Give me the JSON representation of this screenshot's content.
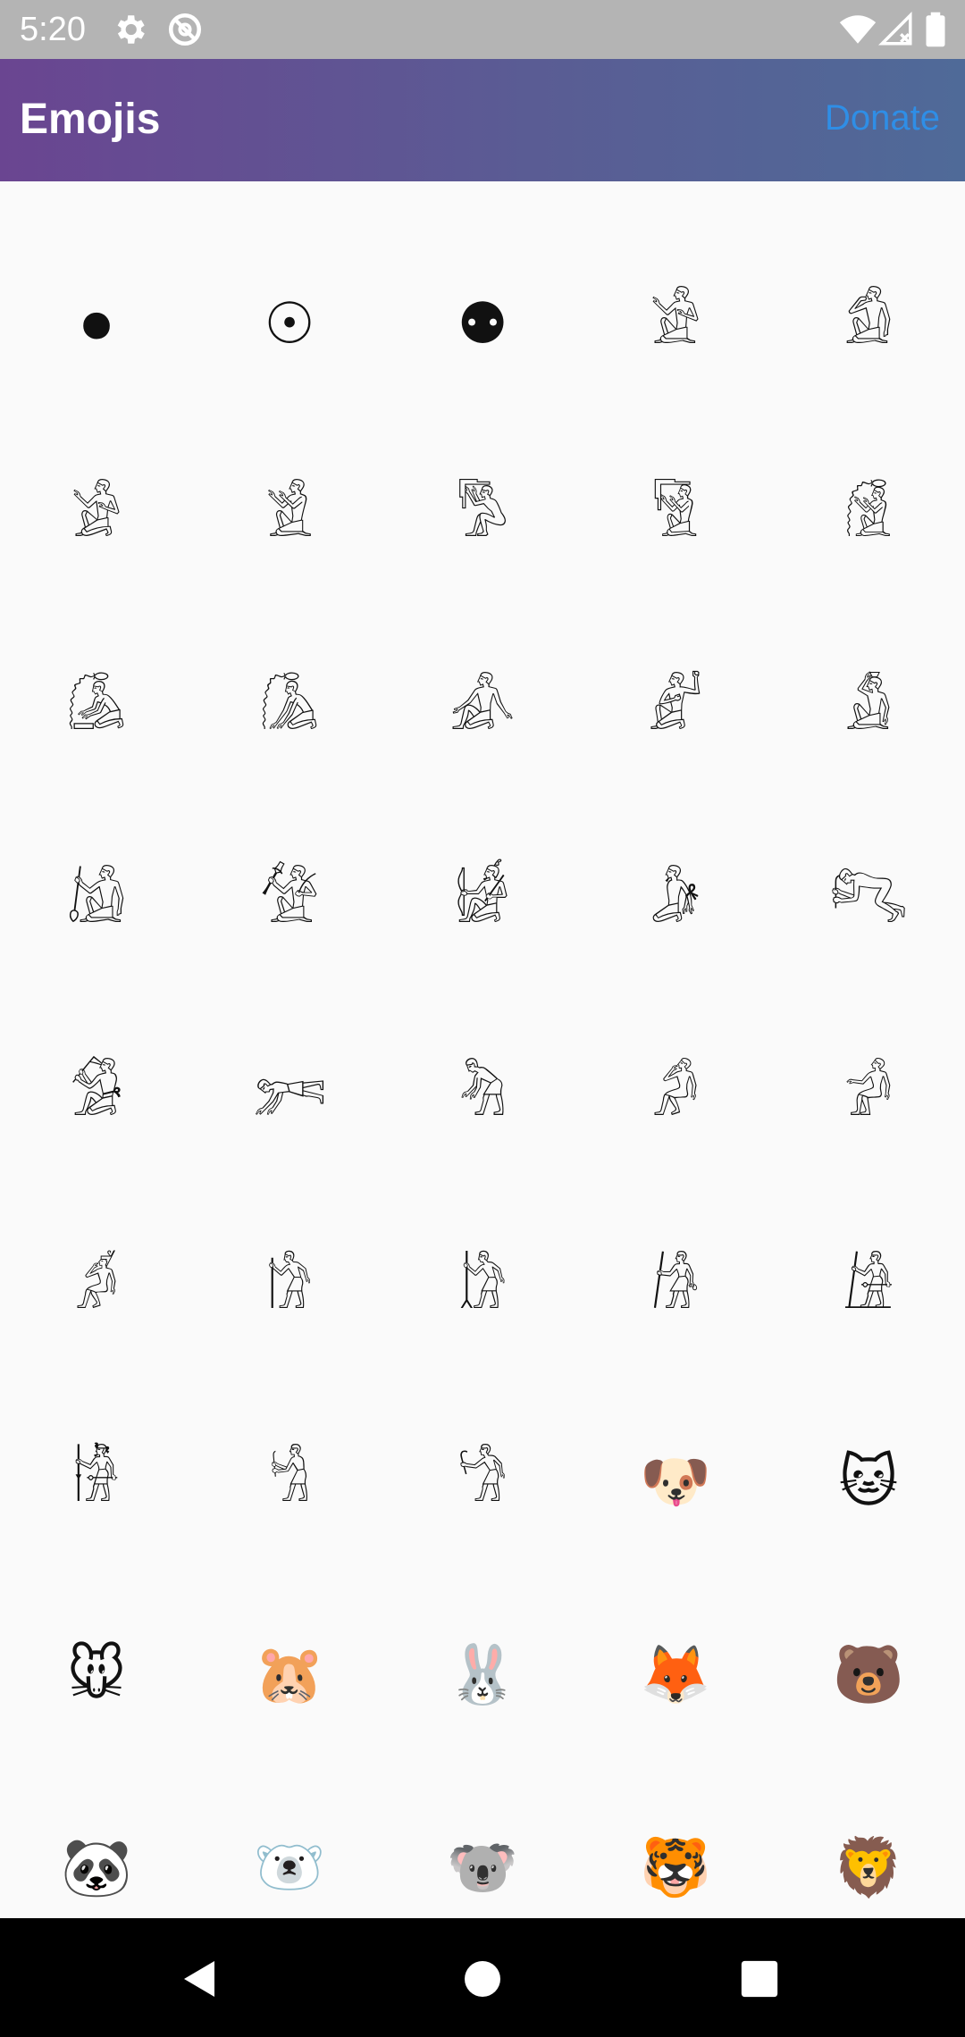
{
  "status_bar": {
    "time": "5:20",
    "icons_left": [
      "gear-icon",
      "data-saver-icon"
    ],
    "icons_right": [
      "wifi-icon",
      "no-signal-icon",
      "battery-icon"
    ]
  },
  "app_bar": {
    "title": "Emojis",
    "donate_label": "Donate",
    "donate_color": "#2f8ee6",
    "gradient": [
      "#6a4591",
      "#4f6a98"
    ]
  },
  "emojis": [
    "⏺",
    "☉",
    "⚉",
    "𓀀",
    "𓀁",
    "𓀂",
    "𓀃",
    "𓀄",
    "𓀅",
    "𓀆",
    "𓀇",
    "𓀈",
    "𓀉",
    "𓀊",
    "𓀋",
    "𓀌",
    "𓀍",
    "𓀎",
    "𓀏",
    "𓀐",
    "𓀑",
    "𓀒",
    "𓀓",
    "𓀔",
    "𓀕",
    "𓀖",
    "𓀗",
    "𓀘",
    "𓀙",
    "𓀚",
    "𓀛",
    "𓀜",
    "𓀝",
    "🐶",
    "🐱",
    "🐭",
    "🐹",
    "🐰",
    "🦊",
    "🐻",
    "🐼",
    "🐻‍❄️",
    "🐨",
    "🐯",
    "🦁"
  ],
  "nav_bar": {
    "buttons": [
      "back-icon",
      "home-icon",
      "recents-icon"
    ]
  }
}
